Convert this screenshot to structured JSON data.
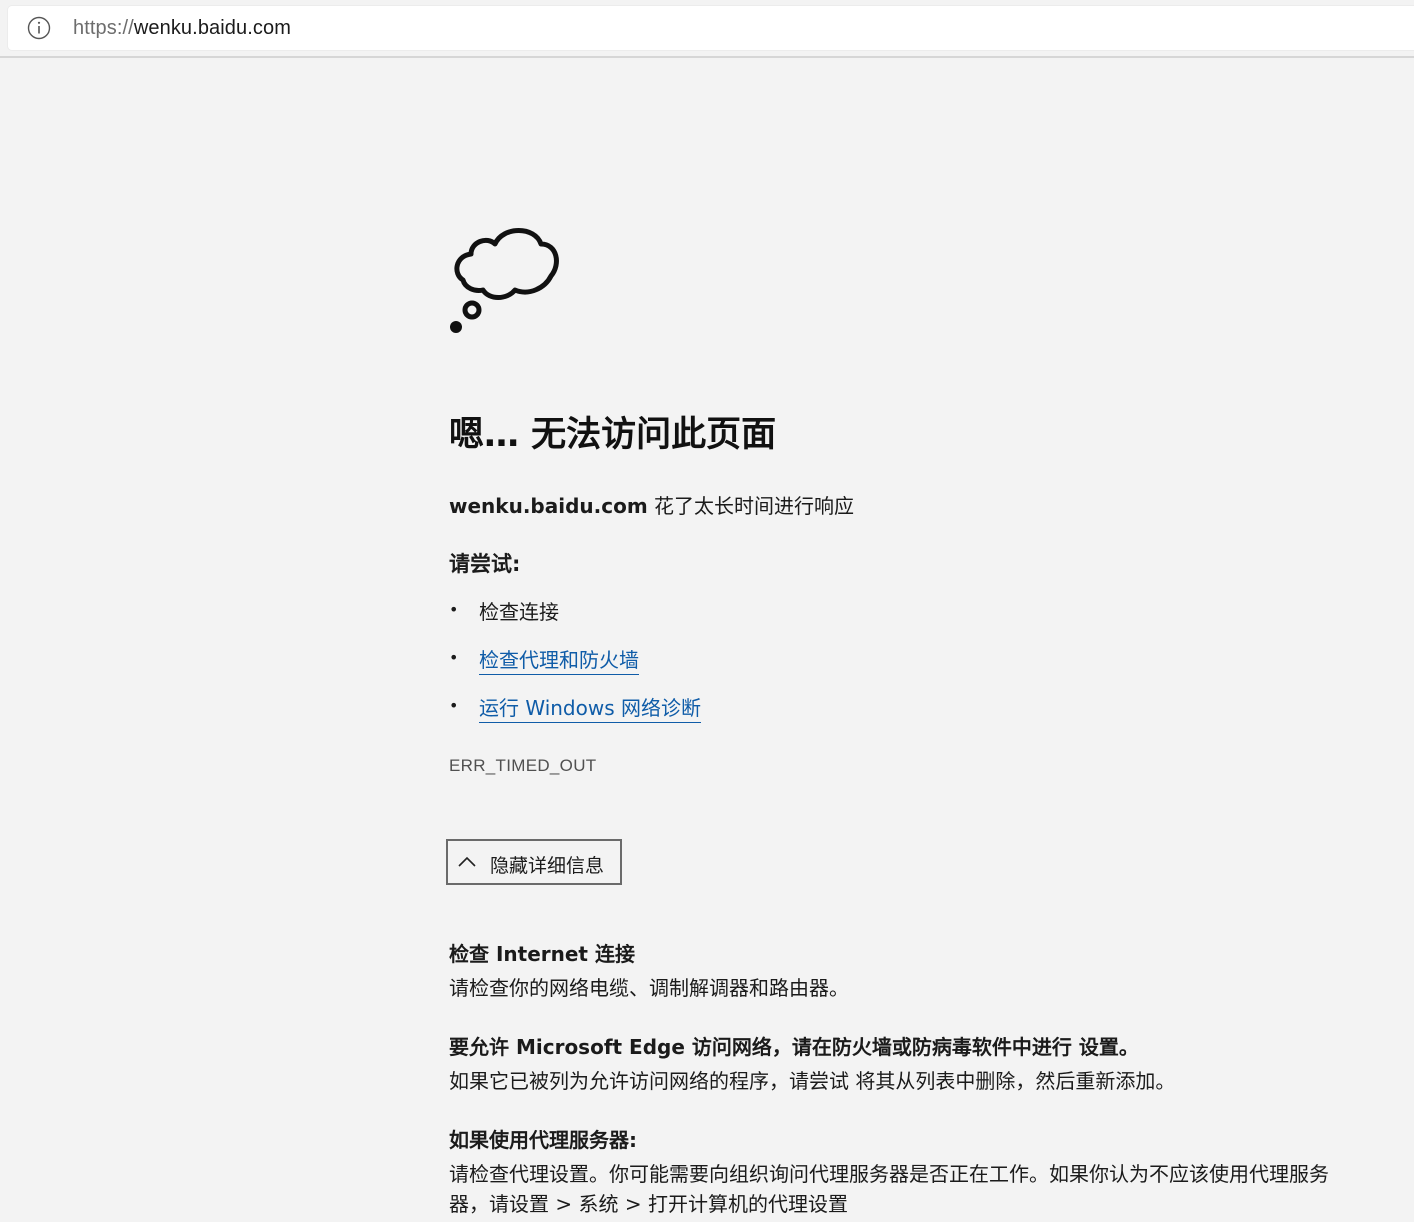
{
  "browser": {
    "url_scheme": "https://",
    "url_host": "wenku.baidu.com",
    "info_icon": "info-circle-icon"
  },
  "error_page": {
    "illustration": "thought-cloud-icon",
    "title": "嗯… 无法访问此页面",
    "subtitle_host": "wenku.baidu.com",
    "subtitle_text": " 花了太长时间进行响应",
    "try_heading": "请尝试:",
    "suggestions": [
      {
        "text": "检查连接",
        "link": false
      },
      {
        "text": "检查代理和防火墙",
        "link": true
      },
      {
        "text": "运行 Windows 网络诊断",
        "link": true
      }
    ],
    "error_code": "ERR_TIMED_OUT",
    "details_button": {
      "label": "隐藏详细信息",
      "icon": "chevron-up-icon"
    },
    "details": [
      {
        "heading": "检查 Internet 连接",
        "body": "请检查你的网络电缆、调制解调器和路由器。"
      },
      {
        "heading": "要允许 Microsoft Edge 访问网络，请在防火墙或防病毒软件中进行 设置。",
        "body": "如果它已被列为允许访问网络的程序，请尝试 将其从列表中删除，然后重新添加。"
      },
      {
        "heading": "如果使用代理服务器:",
        "body": "请检查代理设置。你可能需要向组织询问代理服务器是否正在工作。如果你认为不应该使用代理服务器，请设置 > 系统 > 打开计算机的代理设置"
      }
    ]
  },
  "colors": {
    "background": "#f3f3f3",
    "link": "#0f5ca8",
    "text": "#1b1b1b",
    "muted": "#505050"
  }
}
